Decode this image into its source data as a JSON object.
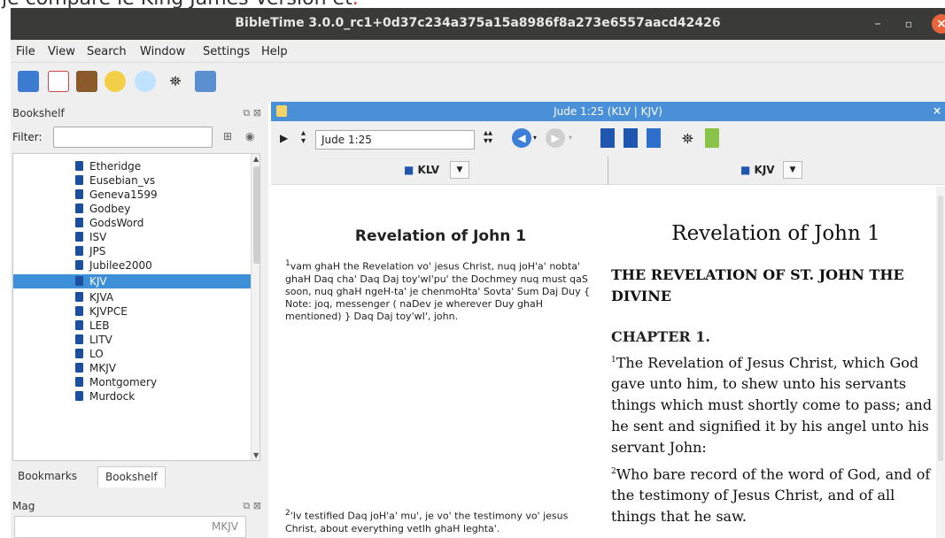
{
  "caption": "je compare le King James Version et",
  "window": {
    "title": "BibleTime 3.0.0_rc1+0d37c234a375a15a8986f8a273e6557aacd42426",
    "minimize": "–",
    "maximize": "▫",
    "close": "×"
  },
  "menu": [
    "File",
    "View",
    "Search",
    "Window",
    "Settings",
    "Help"
  ],
  "toolbar_icons": [
    "bookshelf-icon",
    "bible-icon",
    "book-icon",
    "bookmark-icon",
    "search-icon",
    "binoculars-icon",
    "note-icon"
  ],
  "bookshelf": {
    "title": "Bookshelf",
    "dock_buttons": "⧉ ⊠",
    "filter_label": "Filter:",
    "filter_value": "",
    "items": [
      "Etheridge",
      "Eusebian_vs",
      "Geneva1599",
      "Godbey",
      "GodsWord",
      "ISV",
      "JPS",
      "Jubilee2000",
      "KJV",
      "KJVA",
      "KJVPCE",
      "LEB",
      "LITV",
      "LO",
      "MKJV",
      "Montgomery",
      "Murdock"
    ],
    "selected": "KJV"
  },
  "tabs": [
    "Bookmarks",
    "Bookshelf"
  ],
  "active_tab": "Bookshelf",
  "mag": {
    "title": "Mag",
    "value": "MKJV"
  },
  "display": {
    "title": "Jude 1:25 (KLV | KJV)",
    "reference": "Jude 1:25",
    "modules": [
      "KLV",
      "KJV"
    ]
  },
  "klv": {
    "heading": "Revelation of John 1",
    "verse1": "vam ghaH the Revelation vo' jesus Christ, nuq joH'a' nobta' ghaH Daq cha' Daq Daj toy'wI'pu' the Dochmey nuq must qaS soon, nuq ghaH ngeH-ta' je chenmoHta' Sovta' Sum Daj Duy { Note: joq, messenger ( naDev je wherever Duy ghaH mentioned) } Daq Daj toy'wI', john.",
    "verse2": "'Iv testified Daq joH'a' mu', je vo' the testimony vo' jesus Christ, about everything vetlh ghaH leghta'."
  },
  "kjv": {
    "heading": "Revelation of John 1",
    "subheading": "THE REVELATION OF ST. JOHN THE DIVINE",
    "chapter": "CHAPTER 1.",
    "verse1": "The Revelation of Jesus Christ, which God gave unto him, to shew unto his servants things which must shortly come to pass; and he sent and signified it by his angel unto his servant John:",
    "verse2": "Who bare record of the word of God, and of the testimony of Jesus Christ, and of all things that he saw."
  }
}
